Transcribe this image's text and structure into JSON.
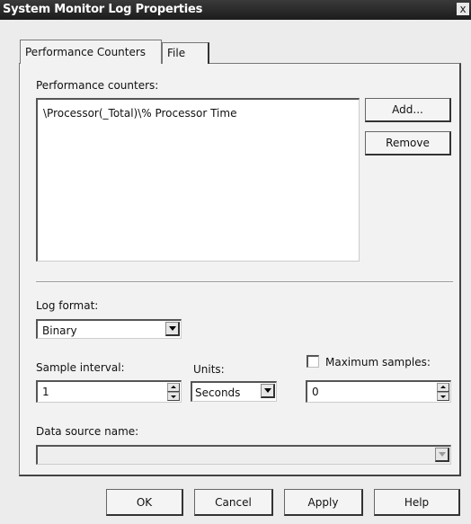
{
  "window": {
    "title": "System Monitor Log Properties",
    "close_symbol": "x"
  },
  "tabs": [
    {
      "label": "Performance Counters",
      "active": true
    },
    {
      "label": "File",
      "active": false
    }
  ],
  "counters": {
    "label": "Performance counters:",
    "items": [
      "\\Processor(_Total)\\% Processor Time"
    ],
    "add_label": "Add...",
    "remove_label": "Remove"
  },
  "log_format": {
    "label": "Log format:",
    "value": "Binary"
  },
  "sample_interval": {
    "label": "Sample interval:",
    "value": "1"
  },
  "units": {
    "label": "Units:",
    "value": "Seconds"
  },
  "max_samples": {
    "label": "Maximum samples:",
    "checked": false,
    "value": "0"
  },
  "data_source": {
    "label": "Data source name:",
    "value": ""
  },
  "footer": {
    "ok_label": "OK",
    "cancel_label": "Cancel",
    "apply_label": "Apply",
    "help_label": "Help"
  },
  "icons": {
    "dropdown": "chevron-down-icon",
    "spinner": "spin-arrows-icon"
  }
}
